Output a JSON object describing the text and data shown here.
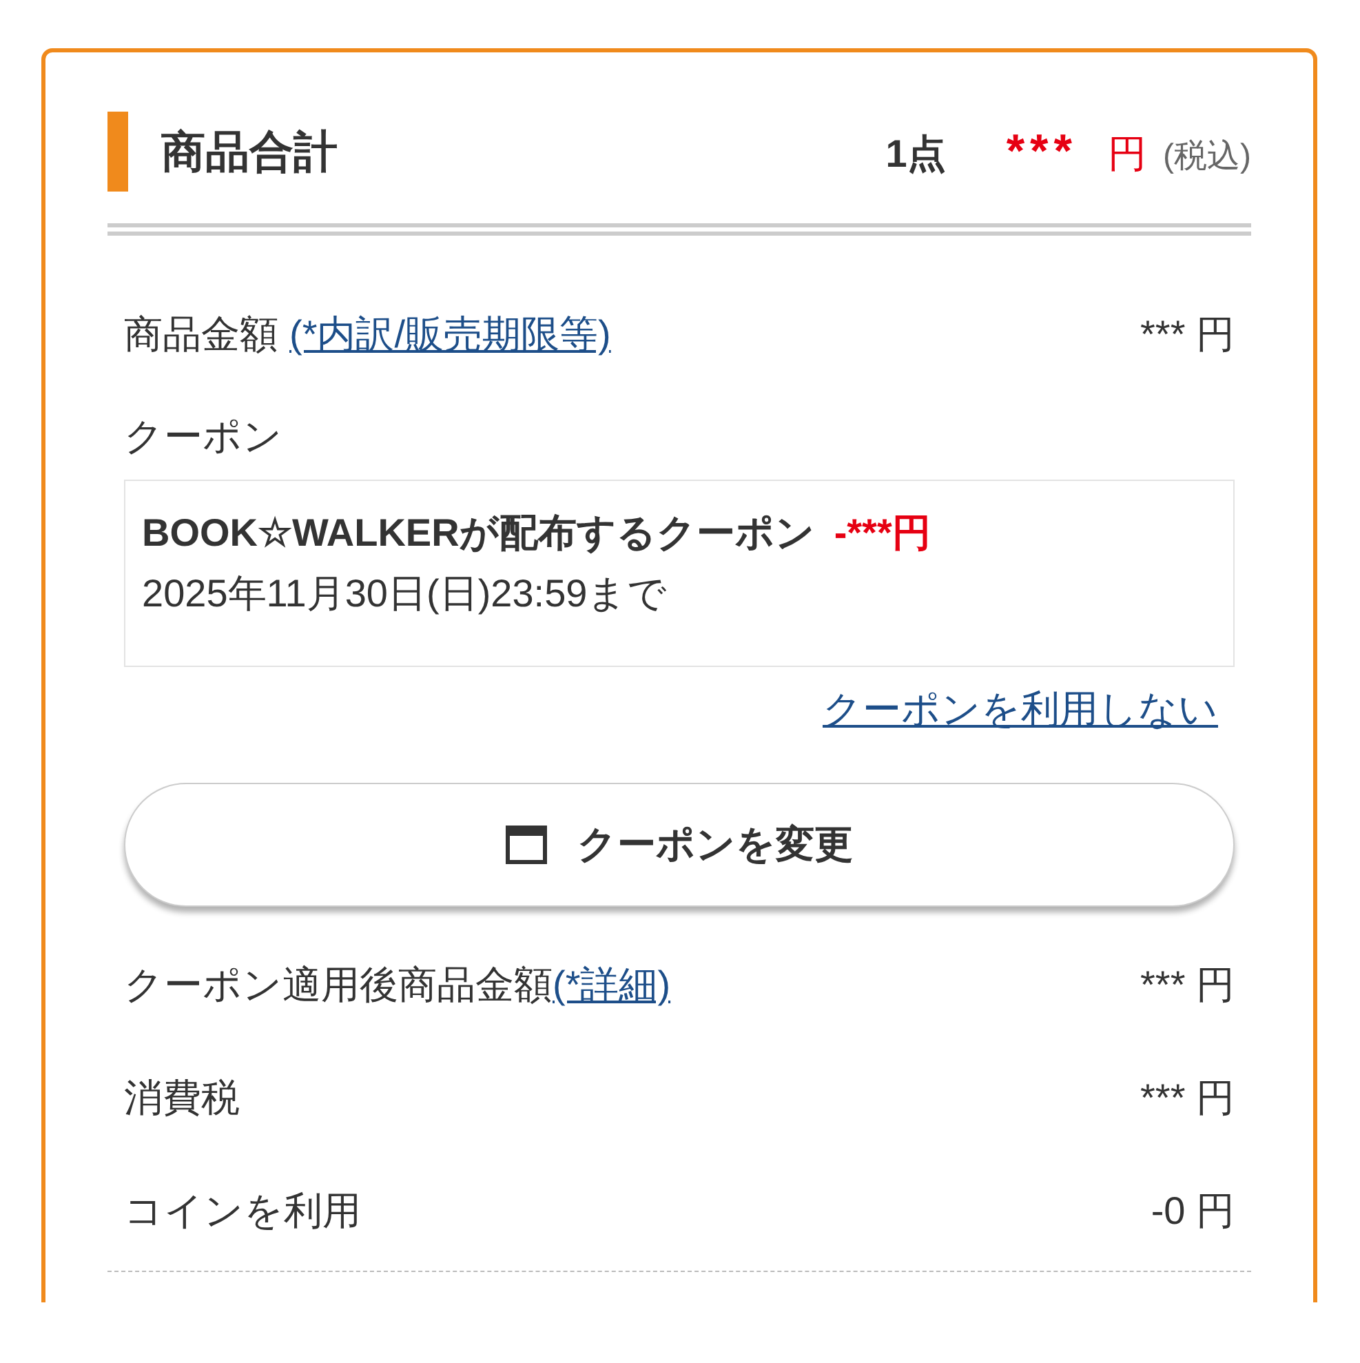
{
  "summary": {
    "title": "商品合計",
    "count": "1点",
    "total": "***",
    "currency": "円",
    "tax_note": "(税込)"
  },
  "price_row": {
    "label": "商品金額",
    "link": "(*内訳/販売期限等)",
    "value": "*** 円"
  },
  "coupon": {
    "label": "クーポン",
    "name": "BOOK☆WALKERが配布するクーポン",
    "discount": "-***円",
    "expiry": "2025年11月30日(日)23:59まで",
    "remove_link": "クーポンを利用しない",
    "change_button": "クーポンを変更"
  },
  "after_row": {
    "label": "クーポン適用後商品金額",
    "link": "(*詳細)",
    "value": "*** 円"
  },
  "rows": [
    {
      "label": "消費税",
      "value": "*** 円"
    },
    {
      "label": "コインを利用",
      "value": "-0 円"
    }
  ]
}
